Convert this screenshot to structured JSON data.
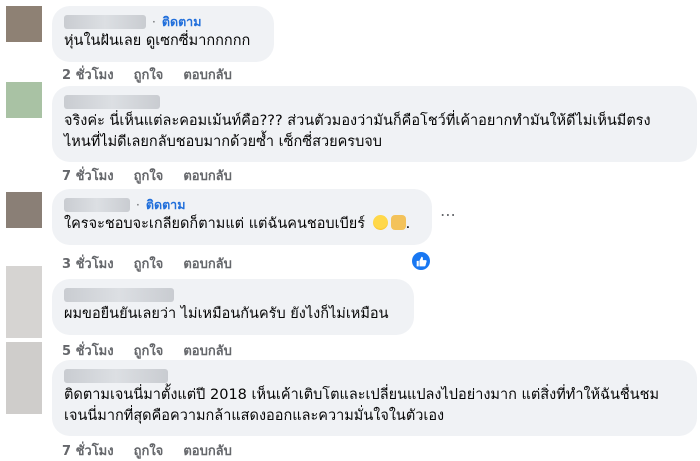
{
  "colors": {
    "bubble": "#f0f2f5",
    "follow": "#216fdb",
    "meta": "#65676b",
    "like": "#1877f2"
  },
  "comments": [
    {
      "show_follow": true,
      "follow_label": "ติดตาม",
      "separator": "·",
      "lines": [
        "หุ่นในฝันเลย ดูเซกซี่มากกกกก"
      ],
      "time": "2 ชั่วโมง",
      "like_label": "ถูกใจ",
      "reply_label": "ตอบกลับ"
    },
    {
      "show_follow": false,
      "lines": [
        "จริงค่ะ นี่เห็นแต่ละคอมเม้นท์คือ??? ส่วนตัวมองว่ามันก็คือโชว์ที่เค้าอยากทำมันให้ดีไม่เห็นมีตรง",
        "ไหนที่ไม่ดีเลยกลับชอบมากด้วยซ้ำ เซ็กซี่สวยครบจบ"
      ],
      "time": "7 ชั่วโมง",
      "like_label": "ถูกใจ",
      "reply_label": "ตอบกลับ"
    },
    {
      "show_follow": true,
      "follow_label": "ติดตาม",
      "separator": "·",
      "lines": [
        "ใครจะชอบจะเกลียดก็ตามแต่ แต่ฉันคนชอบเบียร์ "
      ],
      "line_tail": ".",
      "emojis": [
        "grinning-face-emoji",
        "raised-hands-emoji"
      ],
      "time": "3 ชั่วโมง",
      "like_label": "ถูกใจ",
      "reply_label": "ตอบกลับ",
      "more_icon": "more-horizontal-icon",
      "reaction_icon": "like-thumb-icon"
    },
    {
      "show_follow": false,
      "lines": [
        "ผมขอยืนยันเลยว่า ไม่เหมือนกันครับ ยังไงก็ไม่เหมือน"
      ],
      "time": "5 ชั่วโมง",
      "like_label": "ถูกใจ",
      "reply_label": "ตอบกลับ"
    },
    {
      "show_follow": false,
      "lines": [
        "ติดตามเจนนี่มาตั้งแต่ปี 2018 เห็นเค้าเติบโตและเปลี่ยนแปลงไปอย่างมาก แต่สิ่งที่ทำให้ฉันชื่นชม",
        "เจนนี่มากที่สุดคือความกล้าแสดงออกและความมั่นใจในตัวเอง"
      ],
      "time": "7 ชั่วโมง",
      "like_label": "ถูกใจ",
      "reply_label": "ตอบกลับ"
    }
  ]
}
